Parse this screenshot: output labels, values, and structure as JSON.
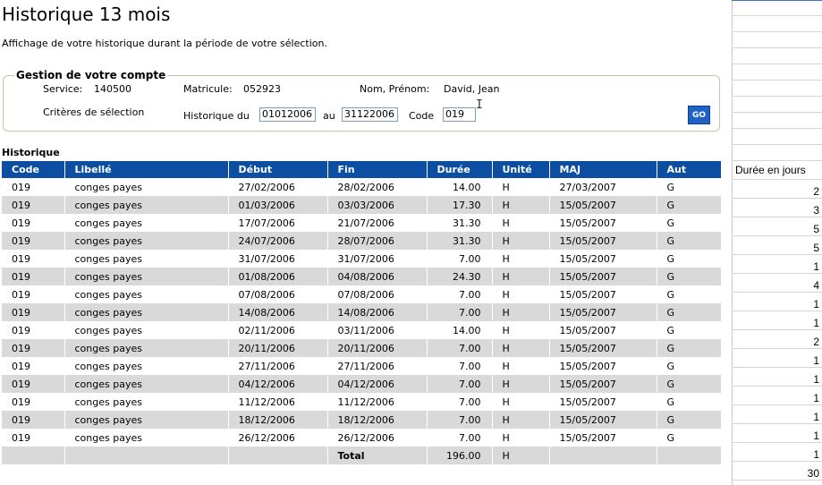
{
  "page": {
    "title": "Historique 13 mois",
    "subtitle": "Affichage de votre historique durant la période de votre sélection."
  },
  "account": {
    "legend": "Gestion de votre compte",
    "service_label": "Service:",
    "service_value": "140500",
    "matricule_label": "Matricule:",
    "matricule_value": "052923",
    "nom_label": "Nom, Prénom:",
    "nom_value": "David, Jean",
    "criteria_label": "Critères de sélection",
    "historique_du_label": "Historique du",
    "date_from": "01012006",
    "au_label": "au",
    "date_to": "31122006",
    "code_label": "Code",
    "code_value": "019",
    "go_label": "GO"
  },
  "history": {
    "title": "Historique",
    "columns": [
      "Code",
      "Libellé",
      "Début",
      "Fin",
      "Durée",
      "Unité",
      "MAJ",
      "Aut"
    ],
    "rows": [
      [
        "019",
        "conges payes",
        "27/02/2006",
        "28/02/2006",
        "14.00",
        "H",
        "27/03/2007",
        "G"
      ],
      [
        "019",
        "conges payes",
        "01/03/2006",
        "03/03/2006",
        "17.30",
        "H",
        "15/05/2007",
        "G"
      ],
      [
        "019",
        "conges payes",
        "17/07/2006",
        "21/07/2006",
        "31.30",
        "H",
        "15/05/2007",
        "G"
      ],
      [
        "019",
        "conges payes",
        "24/07/2006",
        "28/07/2006",
        "31.30",
        "H",
        "15/05/2007",
        "G"
      ],
      [
        "019",
        "conges payes",
        "31/07/2006",
        "31/07/2006",
        "7.00",
        "H",
        "15/05/2007",
        "G"
      ],
      [
        "019",
        "conges payes",
        "01/08/2006",
        "04/08/2006",
        "24.30",
        "H",
        "15/05/2007",
        "G"
      ],
      [
        "019",
        "conges payes",
        "07/08/2006",
        "07/08/2006",
        "7.00",
        "H",
        "15/05/2007",
        "G"
      ],
      [
        "019",
        "conges payes",
        "14/08/2006",
        "14/08/2006",
        "7.00",
        "H",
        "15/05/2007",
        "G"
      ],
      [
        "019",
        "conges payes",
        "02/11/2006",
        "03/11/2006",
        "14.00",
        "H",
        "15/05/2007",
        "G"
      ],
      [
        "019",
        "conges payes",
        "20/11/2006",
        "20/11/2006",
        "7.00",
        "H",
        "15/05/2007",
        "G"
      ],
      [
        "019",
        "conges payes",
        "27/11/2006",
        "27/11/2006",
        "7.00",
        "H",
        "15/05/2007",
        "G"
      ],
      [
        "019",
        "conges payes",
        "04/12/2006",
        "04/12/2006",
        "7.00",
        "H",
        "15/05/2007",
        "G"
      ],
      [
        "019",
        "conges payes",
        "11/12/2006",
        "11/12/2006",
        "7.00",
        "H",
        "15/05/2007",
        "G"
      ],
      [
        "019",
        "conges payes",
        "18/12/2006",
        "18/12/2006",
        "7.00",
        "H",
        "15/05/2007",
        "G"
      ],
      [
        "019",
        "conges payes",
        "26/12/2006",
        "26/12/2006",
        "7.00",
        "H",
        "15/05/2007",
        "G"
      ]
    ],
    "total_label": "Total",
    "total_value": "196.00",
    "total_unit": "H"
  },
  "sidebar": {
    "header": "Durée en jours",
    "values": [
      "2",
      "3",
      "5",
      "5",
      "1",
      "4",
      "1",
      "1",
      "2",
      "1",
      "1",
      "1",
      "1",
      "1",
      "1"
    ],
    "total": "30"
  },
  "colors": {
    "header_bg": "#0b4ea2",
    "alt_row_bg": "#d9d9d9",
    "go_button_bg": "#1e62c6"
  }
}
